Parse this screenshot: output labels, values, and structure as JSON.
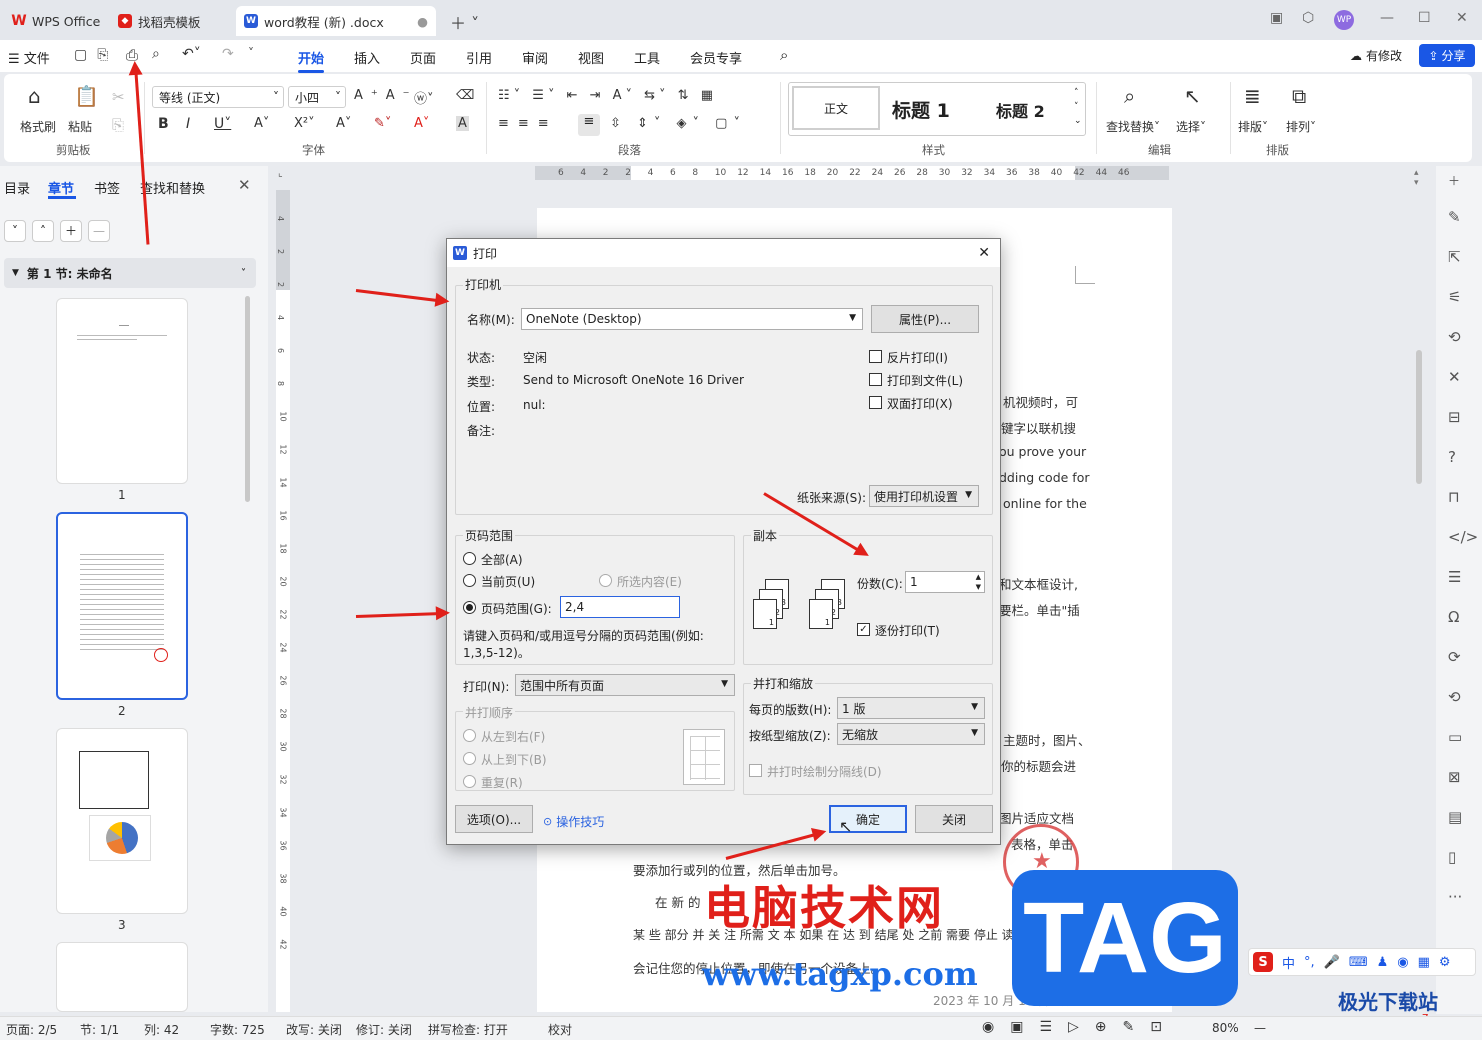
{
  "tabs": [
    {
      "label": "WPS Office"
    },
    {
      "label": "找稻壳模板"
    },
    {
      "label": "word教程 (新) .docx"
    }
  ],
  "menubar": {
    "file": "文件",
    "items": [
      "开始",
      "插入",
      "页面",
      "引用",
      "审阅",
      "视图",
      "工具",
      "会员专享"
    ],
    "revise": "有修改",
    "share": "分享"
  },
  "ribbon": {
    "format_painter": "格式刷",
    "paste": "粘贴",
    "clipboard": "剪贴板",
    "font_name": "等线 (正文)",
    "font_size": "小四",
    "font": "字体",
    "paragraph": "段落",
    "style_normal": "正文",
    "style_h1": "标题 1",
    "style_h2": "标题 2",
    "styles": "样式",
    "find_replace": "查找替换",
    "select": "选择",
    "edit": "编辑",
    "arrange_layout": "排版",
    "arrange": "排列",
    "arrange_group": "排版"
  },
  "leftpane": {
    "tabs": [
      "目录",
      "章节",
      "书签",
      "查找和替换"
    ],
    "section": "第 1 节: 未命名",
    "pages": [
      "1",
      "2",
      "3"
    ]
  },
  "ruler": [
    "6",
    "4",
    "2",
    "2",
    "4",
    "6",
    "8",
    "10",
    "12",
    "14",
    "16",
    "18",
    "20",
    "22",
    "24",
    "26",
    "28",
    "30",
    "32",
    "34",
    "36",
    "38",
    "40",
    "42",
    "44",
    "46"
  ],
  "vruler": [
    "4",
    "2",
    "2",
    "4",
    "6",
    "8",
    "10",
    "12",
    "14",
    "16",
    "18",
    "20",
    "22",
    "24",
    "26",
    "28",
    "30",
    "32",
    "34",
    "36",
    "38",
    "40",
    "42"
  ],
  "document": {
    "lines": [
      "机视频时，可",
      "键字以联机搜",
      "ou prove your",
      "dding code for",
      "online for the",
      "和文本框设计,",
      "要栏。单击\"插",
      "主题时，图片、",
      "你的标题会进",
      "图片适应文档",
      "表格，单击",
      "要添加行或列的位置，然后单击加号。",
      "在 新 的",
      "某 些 部分 并 关 注 所需 文 本 如果 在 达 到 结尾 处 之前 需要 停止 读取，Word",
      "会记住您的停止位置，即使在另一个设备上。",
      "2023 年 10 月 17 日星期二"
    ]
  },
  "dialog": {
    "title": "打印",
    "printer_group": "打印机",
    "name_label": "名称(M):",
    "printer_name": "OneNote (Desktop)",
    "properties": "属性(P)...",
    "status_label": "状态:",
    "status": "空闲",
    "type_label": "类型:",
    "type": "Send to Microsoft OneNote 16 Driver",
    "location_label": "位置:",
    "location": "nul:",
    "comment_label": "备注:",
    "reverse": "反片打印(I)",
    "to_file": "打印到文件(L)",
    "duplex": "双面打印(X)",
    "paper_source_label": "纸张来源(S):",
    "paper_source": "使用打印机设置",
    "range_group": "页码范围",
    "all": "全部(A)",
    "current": "当前页(U)",
    "selection": "所选内容(E)",
    "pages_label": "页码范围(G):",
    "pages_value": "2,4",
    "hint": "请键入页码和/或用逗号分隔的页码范围(例如:",
    "hint2": "1,3,5-12)。",
    "copies_group": "副本",
    "copies_label": "份数(C):",
    "copies_value": "1",
    "collate": "逐份打印(T)",
    "print_label": "打印(N):",
    "print_value": "范围中所有页面",
    "order_group": "并打顺序",
    "ltr": "从左到右(F)",
    "ttb": "从上到下(B)",
    "repeat": "重复(R)",
    "zoom_group": "并打和缩放",
    "pps_label": "每页的版数(H):",
    "pps_value": "1 版",
    "scale_label": "按纸型缩放(Z):",
    "scale_value": "无缩放",
    "draw_lines": "并打时绘制分隔线(D)",
    "options": "选项(O)...",
    "tips": "操作技巧",
    "ok": "确定",
    "close": "关闭"
  },
  "status": {
    "page": "页面: 2/5",
    "section": "节: 1/1",
    "col": "列: 42",
    "words": "字数: 725",
    "revise": "改写: 关闭",
    "track": "修订: 关闭",
    "spell": "拼写检查: 打开",
    "proof": "校对",
    "zoom": "80%"
  },
  "watermark": {
    "site": "电脑技术网",
    "url": "www.tagxp.com",
    "tag": "TAG",
    "brand": "极光下载站",
    "brand_url": "www.xz7.com"
  },
  "ime": [
    "中",
    "°,"
  ],
  "colors": {
    "accent": "#1a57e5",
    "arrow": "#e0201a",
    "tag_blue": "#1d6ee6"
  }
}
